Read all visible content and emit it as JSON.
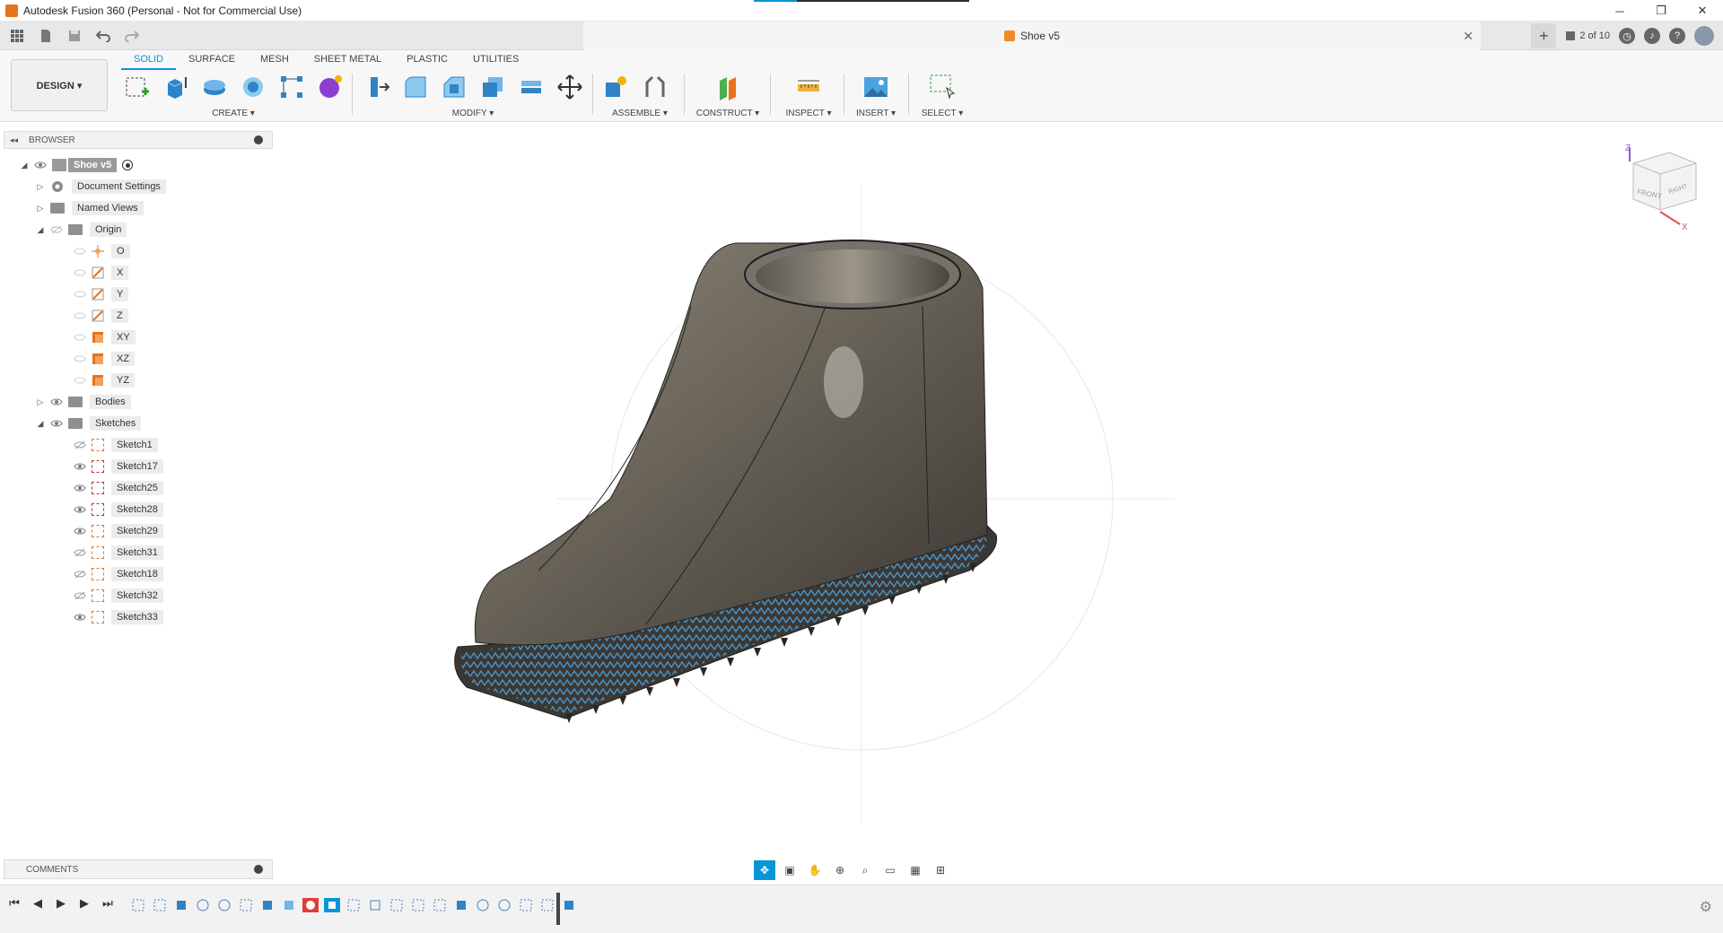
{
  "window": {
    "title": "Autodesk Fusion 360 (Personal - Not for Commercial Use)",
    "controls": {
      "minimize": "─",
      "restore": "❐",
      "close": "✕"
    }
  },
  "tabs": {
    "document": "Shoe v5",
    "close": "✕",
    "new_tab": "+",
    "count": "2 of 10"
  },
  "toolbar": {
    "workspace_button": "DESIGN ▾",
    "workspace_tabs": [
      "SOLID",
      "SURFACE",
      "MESH",
      "SHEET METAL",
      "PLASTIC",
      "UTILITIES"
    ],
    "active_tab": "SOLID",
    "groups": {
      "create": "CREATE ▾",
      "modify": "MODIFY ▾",
      "assemble": "ASSEMBLE ▾",
      "construct": "CONSTRUCT ▾",
      "inspect": "INSPECT ▾",
      "insert": "INSERT ▾",
      "select": "SELECT ▾"
    },
    "accent_color": "#0696d7"
  },
  "browser": {
    "title": "BROWSER",
    "root": "Shoe v5",
    "items": [
      {
        "label": "Document Settings",
        "icon": "gear-icon"
      },
      {
        "label": "Named Views",
        "icon": "folder-icon"
      },
      {
        "label": "Origin",
        "icon": "folder-icon"
      },
      {
        "label": "O",
        "icon": "origin-point-icon"
      },
      {
        "label": "X",
        "icon": "axis-icon"
      },
      {
        "label": "Y",
        "icon": "axis-icon"
      },
      {
        "label": "Z",
        "icon": "axis-icon"
      },
      {
        "label": "XY",
        "icon": "plane-icon"
      },
      {
        "label": "XZ",
        "icon": "plane-icon"
      },
      {
        "label": "YZ",
        "icon": "plane-icon"
      },
      {
        "label": "Bodies",
        "icon": "folder-icon"
      },
      {
        "label": "Sketches",
        "icon": "folder-icon"
      },
      {
        "label": "Sketch1",
        "icon": "sketch-icon"
      },
      {
        "label": "Sketch17",
        "icon": "sketch-icon"
      },
      {
        "label": "Sketch25",
        "icon": "sketch-icon"
      },
      {
        "label": "Sketch28",
        "icon": "sketch-icon"
      },
      {
        "label": "Sketch29",
        "icon": "sketch-icon"
      },
      {
        "label": "Sketch31",
        "icon": "sketch-icon"
      },
      {
        "label": "Sketch18",
        "icon": "sketch-icon"
      },
      {
        "label": "Sketch32",
        "icon": "sketch-icon"
      },
      {
        "label": "Sketch33",
        "icon": "sketch-icon"
      }
    ]
  },
  "viewcube": {
    "front": "FRONT",
    "right": "RIGHT",
    "z": "Z",
    "x": "X"
  },
  "comments": {
    "title": "COMMENTS"
  },
  "timeline": {
    "controls": [
      "⏮",
      "◀",
      "▶",
      "▶",
      "⏭"
    ],
    "gear": "⚙"
  }
}
